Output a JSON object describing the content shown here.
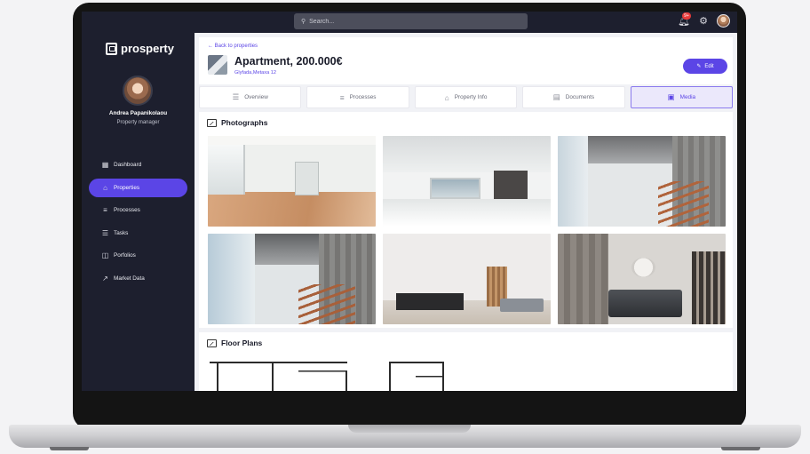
{
  "search": {
    "placeholder": "Search..."
  },
  "notifications": {
    "badge": "9+"
  },
  "brand": {
    "name": "prosperty"
  },
  "user": {
    "name": "Andrea Papanikolaou",
    "role": "Property manager"
  },
  "sidebar": {
    "items": [
      {
        "label": "Dashboard",
        "icon": "grid-icon"
      },
      {
        "label": "Properties",
        "icon": "home-icon",
        "active": true
      },
      {
        "label": "Processes",
        "icon": "processes-icon"
      },
      {
        "label": "Tasks",
        "icon": "list-icon"
      },
      {
        "label": "Porfolios",
        "icon": "portfolio-icon"
      },
      {
        "label": "Market Data",
        "icon": "trend-icon"
      }
    ]
  },
  "property": {
    "back_label": "Back to properties",
    "title": "Apartment, 200.000€",
    "address": "Glyfada,Metaxa 12",
    "edit_label": "Edit"
  },
  "tabs": [
    {
      "label": "Overview",
      "icon": "list-icon"
    },
    {
      "label": "Processes",
      "icon": "processes-icon"
    },
    {
      "label": "Property Info",
      "icon": "house-icon"
    },
    {
      "label": "Documents",
      "icon": "document-icon"
    },
    {
      "label": "Media",
      "icon": "image-icon",
      "active": true
    }
  ],
  "sections": {
    "photos_title": "Photographs",
    "floor_title": "Floor Plans"
  },
  "colors": {
    "accent": "#5b45e6",
    "sidebar": "#1d1f2e",
    "badge": "#e83b3b"
  }
}
